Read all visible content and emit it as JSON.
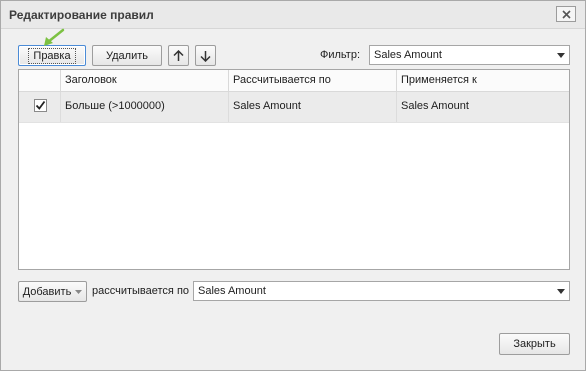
{
  "window": {
    "title": "Редактирование правил",
    "close_icon": "close-icon"
  },
  "toolbar": {
    "edit_label": "Правка",
    "delete_label": "Удалить",
    "move_up_icon": "arrow-up-icon",
    "move_down_icon": "arrow-down-icon",
    "filter_label": "Фильтр:",
    "filter_value": "Sales Amount"
  },
  "grid": {
    "columns": [
      "Заголовок",
      "Рассчитывается по",
      "Применяется к"
    ],
    "rows": [
      {
        "checked": true,
        "title": "Больше (>1000000)",
        "calculated_by": "Sales Amount",
        "applies_to": "Sales Amount"
      }
    ]
  },
  "bottom": {
    "add_label": "Добавить",
    "calculated_by_label": "рассчитывается по",
    "calculated_by_value": "Sales Amount"
  },
  "footer": {
    "close_label": "Закрыть"
  },
  "colors": {
    "annotation_arrow": "#7cc142",
    "focus_border": "#4b8bd6"
  }
}
